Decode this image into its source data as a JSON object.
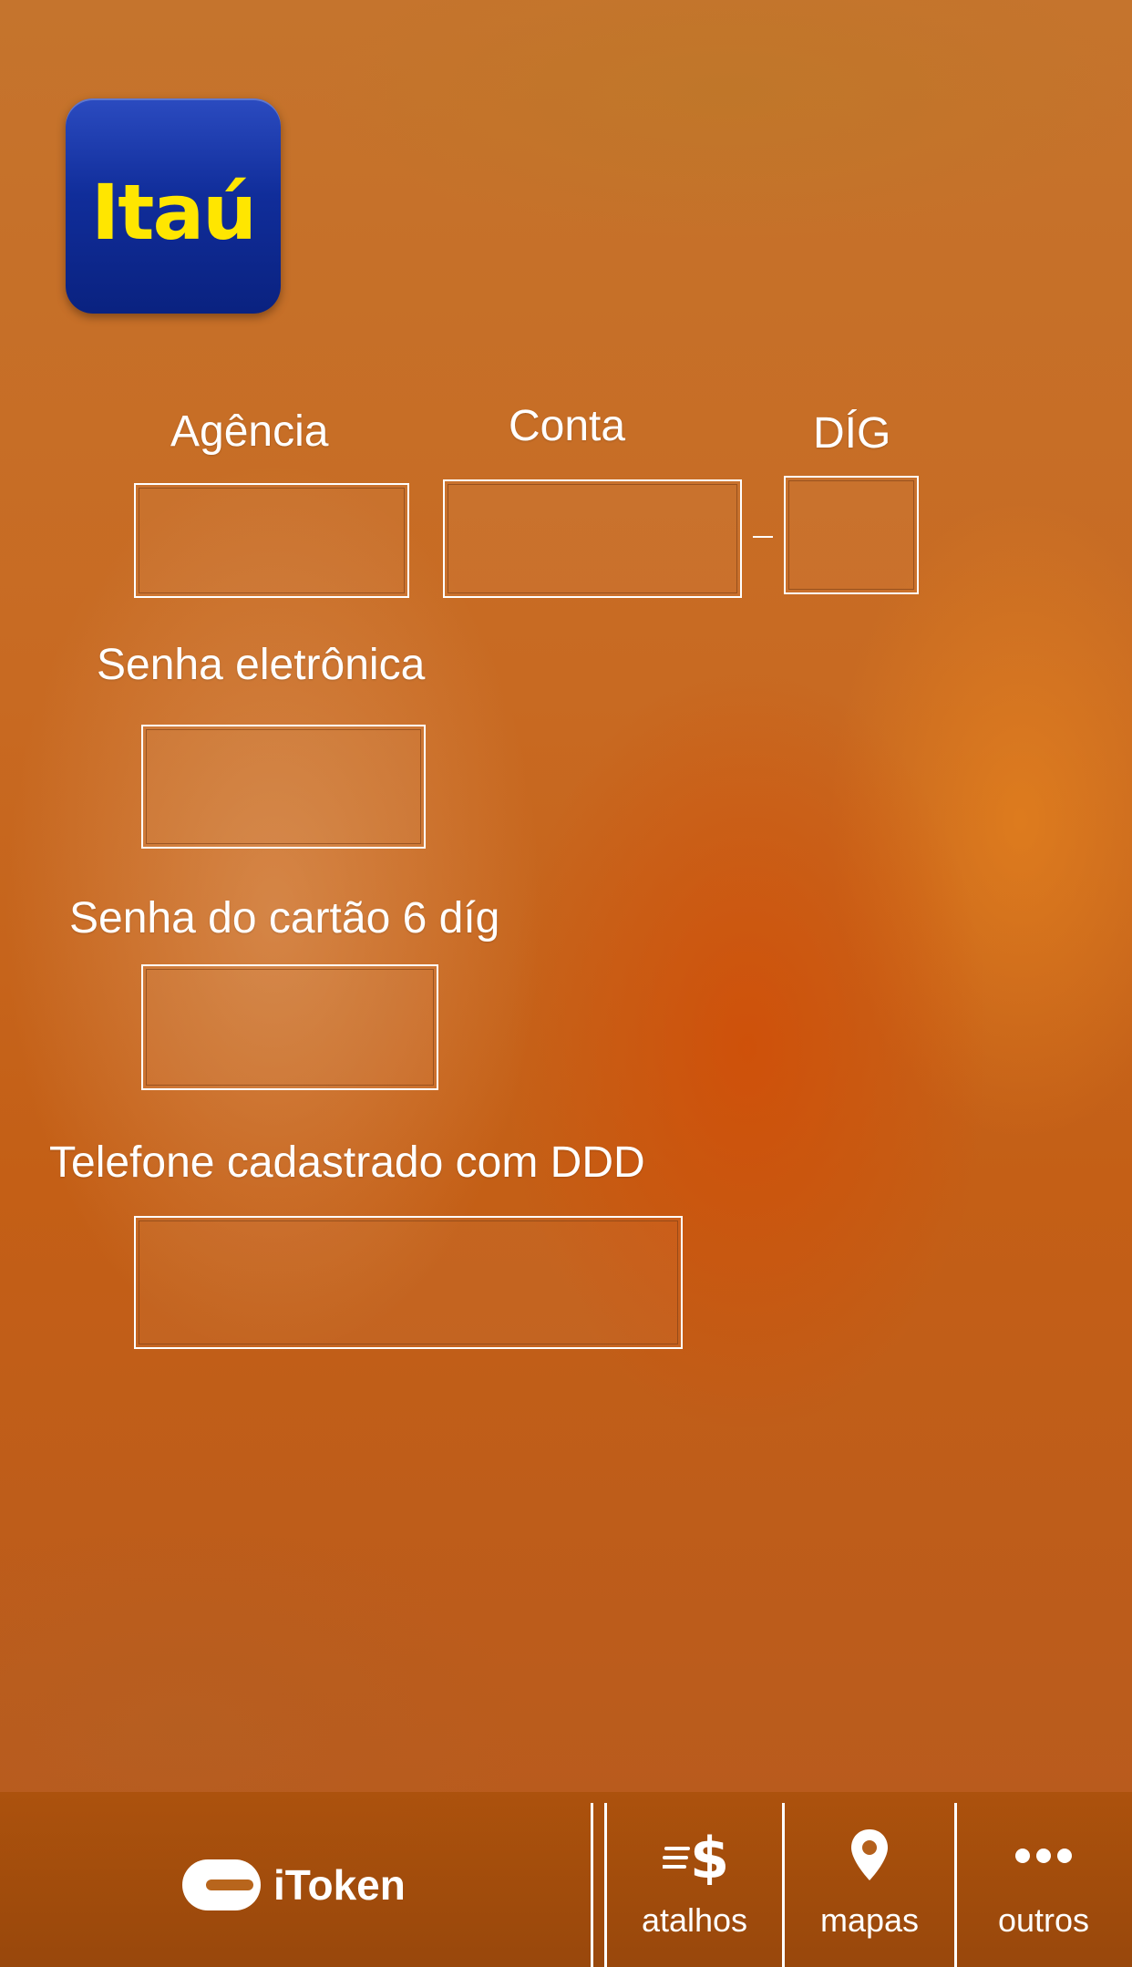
{
  "logo": {
    "text": "Itaú"
  },
  "form": {
    "agencia_label": "Agência",
    "conta_label": "Conta",
    "dig_label": "DÍG",
    "senha_eletronica_label": "Senha eletrônica",
    "senha_cartao_label": "Senha do cartão 6 díg",
    "telefone_label": "Telefone cadastrado com DDD"
  },
  "bottom_bar": {
    "itoken_label": "iToken",
    "items": [
      {
        "label": "atalhos",
        "icon": "money-transfer-icon"
      },
      {
        "label": "mapas",
        "icon": "map-pin-icon"
      },
      {
        "label": "outros",
        "icon": "more-dots-icon"
      }
    ]
  },
  "colors": {
    "brand_blue": "#102d9a",
    "brand_yellow": "#ffe600",
    "background": "#c8651b"
  }
}
